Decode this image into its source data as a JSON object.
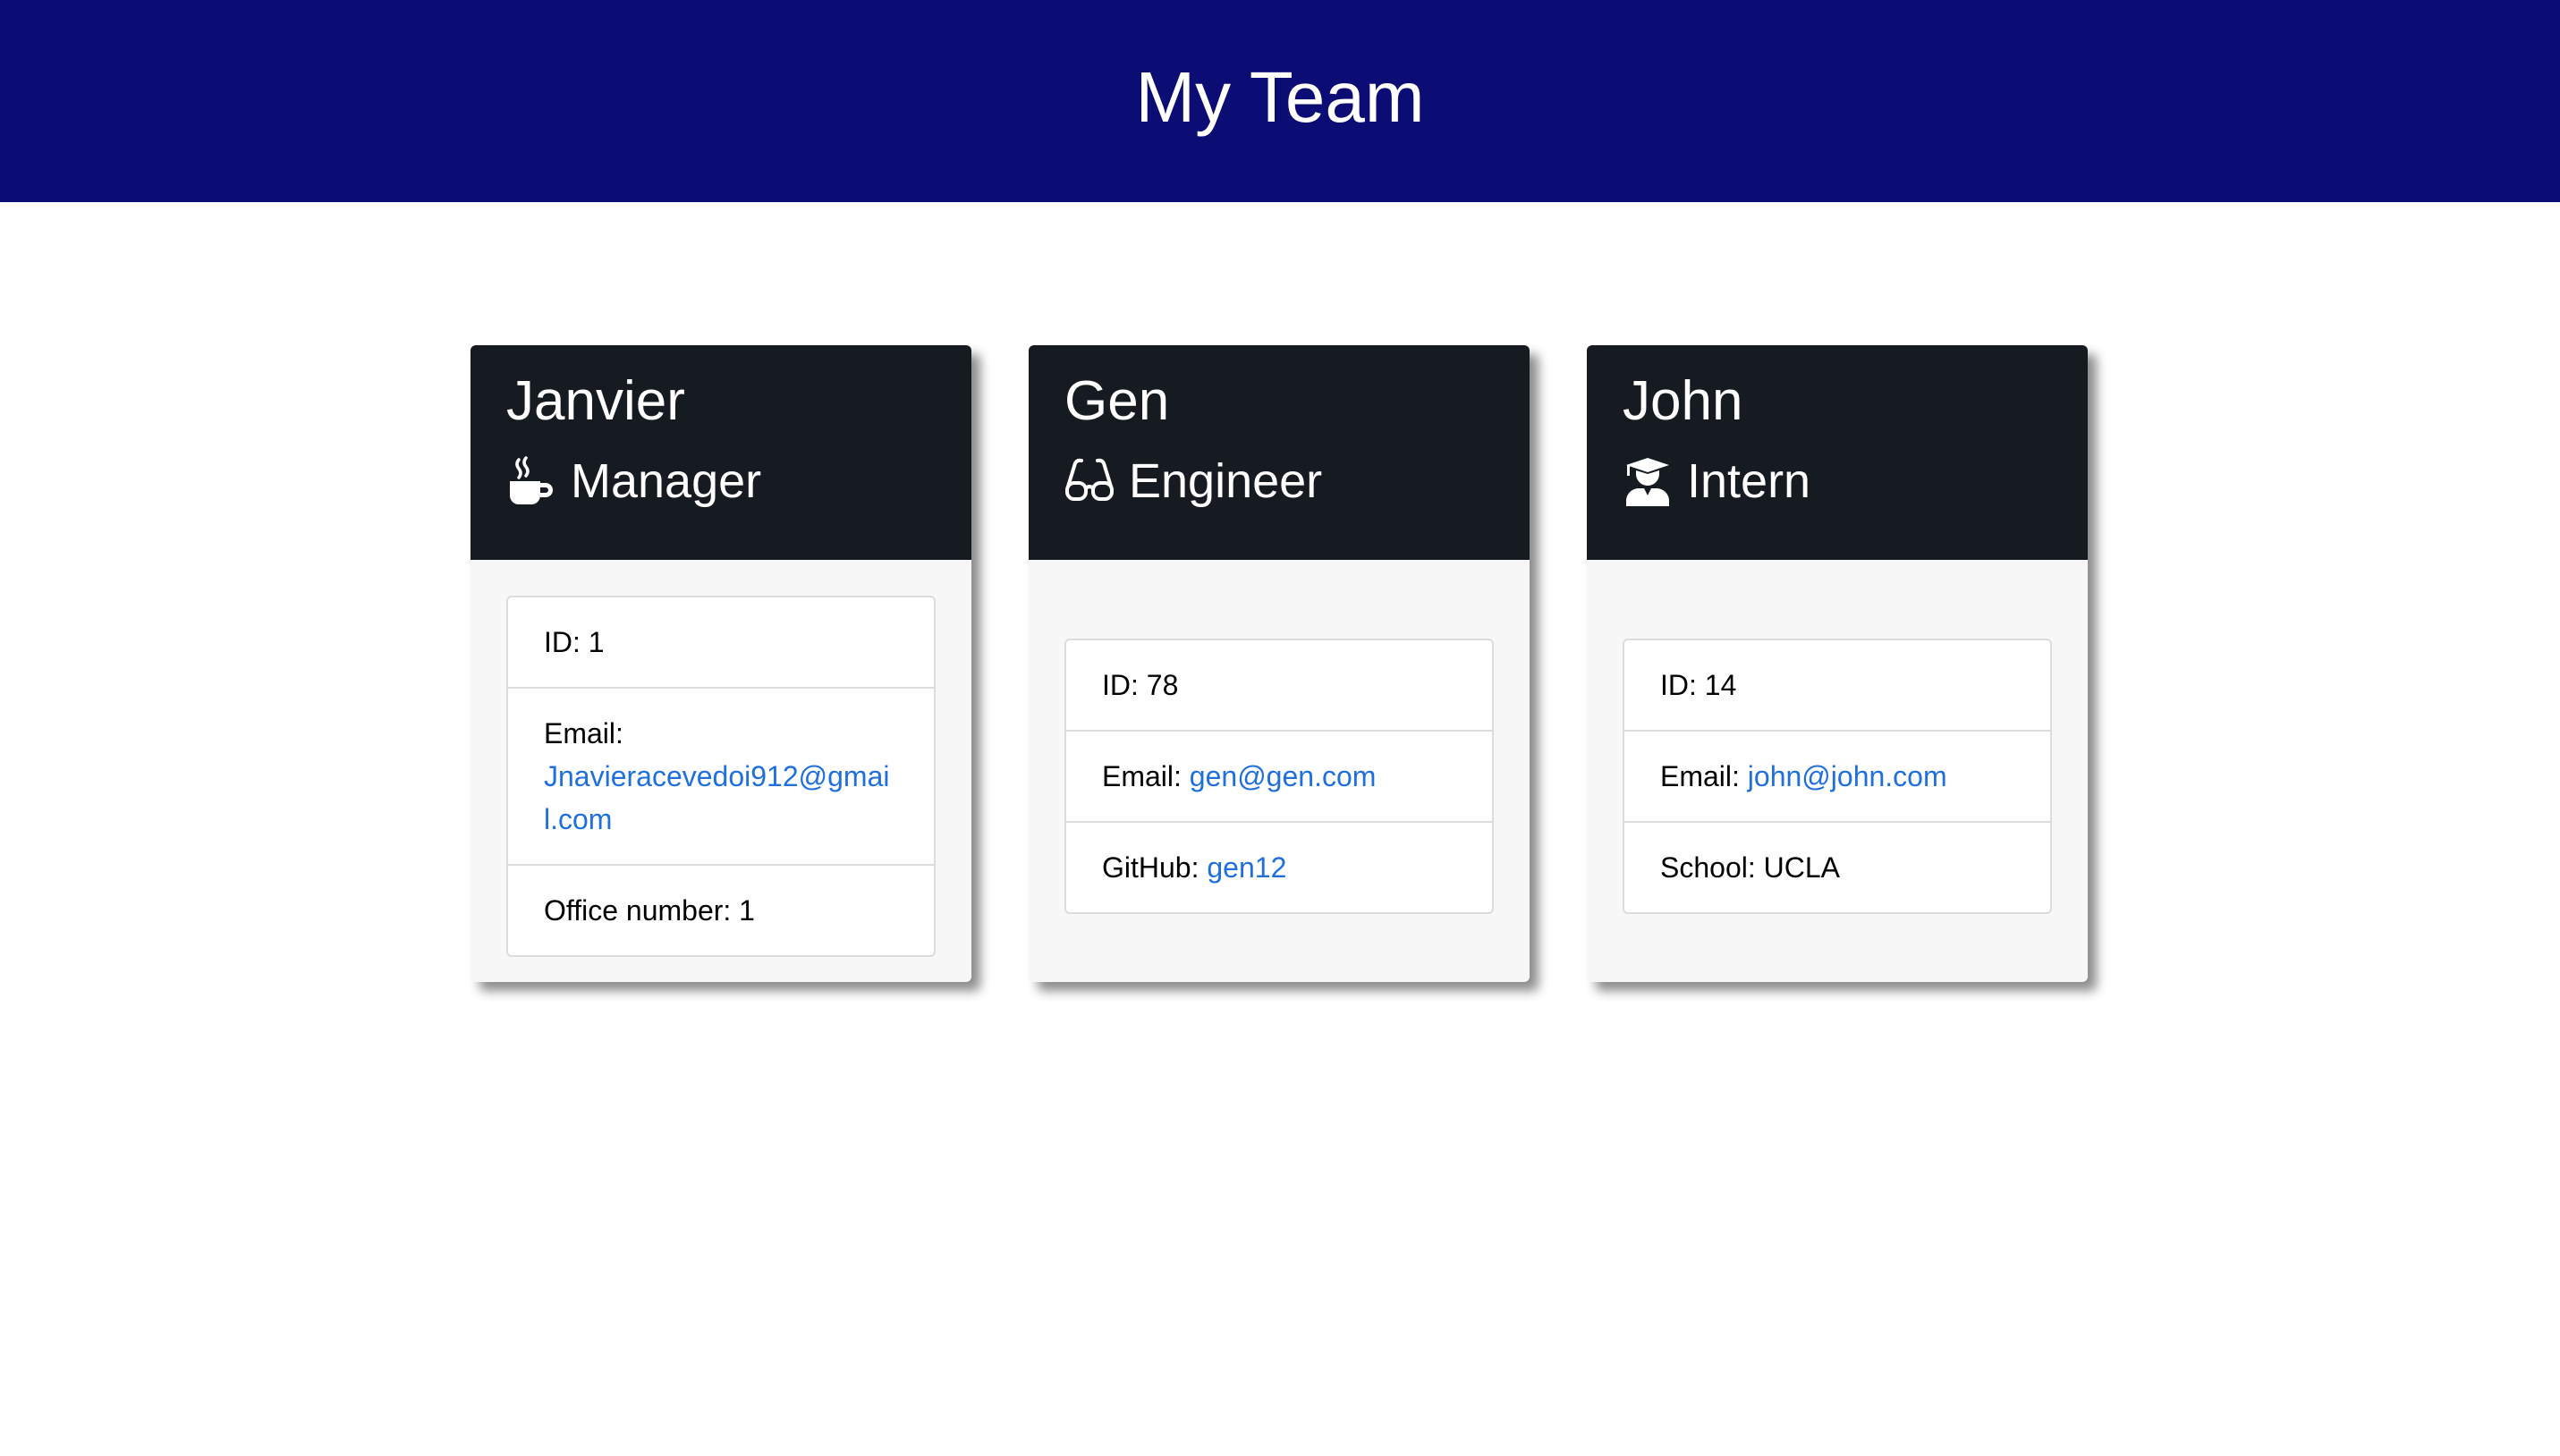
{
  "header": {
    "title": "My Team",
    "background_color": "#0b0c74"
  },
  "link_color": "#1f6fdc",
  "cards": [
    {
      "name": "Janvier",
      "role": "Manager",
      "role_icon": "mug-hot-icon",
      "id_label": "ID: 1",
      "email_prefix": "Email:",
      "email": "Jnavieracevedoi912@gmail.com",
      "extra_prefix": "Office number: 1",
      "extra_value": ""
    },
    {
      "name": "Gen",
      "role": "Engineer",
      "role_icon": "glasses-icon",
      "id_label": "ID: 78",
      "email_prefix": "Email:",
      "email": "gen@gen.com",
      "extra_prefix": "GitHub:",
      "extra_value": "gen12"
    },
    {
      "name": "John",
      "role": "Intern",
      "role_icon": "user-graduate-icon",
      "id_label": "ID: 14",
      "email_prefix": "Email:",
      "email": "john@john.com",
      "extra_prefix": "School: UCLA",
      "extra_value": ""
    }
  ]
}
